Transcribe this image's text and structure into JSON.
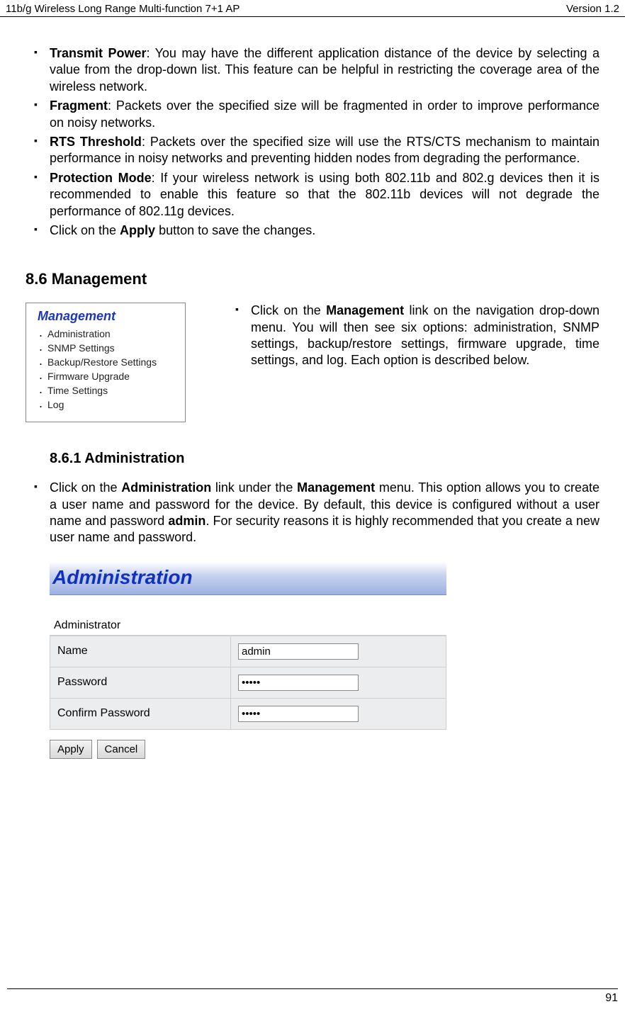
{
  "header": {
    "left": "11b/g Wireless Long Range Multi-function 7+1 AP",
    "right": "Version 1.2"
  },
  "footer": {
    "page": "91"
  },
  "bullets_top": {
    "transmit_power_label": "Transmit Power",
    "transmit_power_text": ": You may have the different application distance of the device by selecting a value from the drop-down list. This feature can be helpful in restricting the coverage area of the wireless network.",
    "fragment_label": "Fragment",
    "fragment_text": ": Packets over the specified size will be fragmented in order to improve performance on noisy networks.",
    "rts_label": "RTS Threshold",
    "rts_text": ": Packets over the specified size will use the RTS/CTS mechanism to maintain performance in noisy networks and preventing hidden nodes from degrading the performance.",
    "protect_label": "Protection Mode",
    "protect_text": ": If your wireless network is using both 802.11b and 802.g devices then it is recommended to enable this feature so that the 802.11b devices will not degrade the performance of 802.11g devices.",
    "apply_prefix": "Click on the ",
    "apply_bold": "Apply",
    "apply_suffix": " button to save the changes."
  },
  "section_8_6": {
    "heading": "8.6   Management",
    "nav_title": "Management",
    "nav_items": [
      "Administration",
      "SNMP Settings",
      "Backup/Restore Settings",
      "Firmware Upgrade",
      "Time Settings",
      "Log"
    ],
    "paragraph_prefix": "Click on the ",
    "paragraph_bold": "Management",
    "paragraph_suffix": " link on the navigation drop-down menu. You will then see six options: administration, SNMP settings, backup/restore settings, firmware upgrade, time settings, and log. Each option is described below."
  },
  "section_8_6_1": {
    "heading": "8.6.1   Administration",
    "p_prefix": "Click on the ",
    "p_bold1": "Administration",
    "p_mid1": " link under the ",
    "p_bold2": "Management",
    "p_mid2": " menu. This option allows you to create a user name and password for the device. By default, this device is configured without a user name and password ",
    "p_bold3": "admin",
    "p_suffix": ". For security reasons it is highly recommended that you create a new user name and password."
  },
  "admin_panel": {
    "banner_title": "Administration",
    "section_label": "Administrator",
    "name_label": "Name",
    "name_value": "admin",
    "password_label": "Password",
    "password_value": "•••••",
    "confirm_label": "Confirm Password",
    "confirm_value": "•••••",
    "apply_btn": "Apply",
    "cancel_btn": "Cancel"
  }
}
